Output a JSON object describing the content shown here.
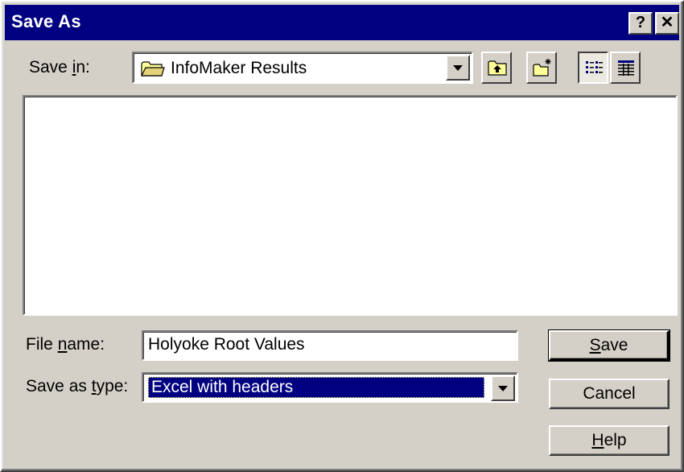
{
  "window": {
    "title": "Save As",
    "help_glyph": "?",
    "close_glyph": "✕"
  },
  "save_in": {
    "label": "Save in:",
    "label_plain": "Save ",
    "label_accel": "i",
    "label_rest": "n:",
    "value": "InfoMaker Results",
    "icon": "folder-icon"
  },
  "toolbar": {
    "up_folder_icon": "up-one-level-icon",
    "new_folder_icon": "new-folder-icon",
    "list_view_icon": "list-view-icon",
    "details_view_icon": "details-view-icon",
    "active_view": "list"
  },
  "file_list": {
    "items": []
  },
  "file_name": {
    "label_plain": "File ",
    "label_accel": "n",
    "label_rest": "ame:",
    "value": "Holyoke Root Values"
  },
  "save_as_type": {
    "label_plain": "Save as ",
    "label_accel": "t",
    "label_rest": "ype:",
    "selected": "Excel with headers"
  },
  "buttons": {
    "save_accel": "S",
    "save_rest": "ave",
    "cancel": "Cancel",
    "help_accel": "H",
    "help_rest": "elp"
  },
  "colors": {
    "titlebar": "#000080",
    "face": "#d4d0c8",
    "selection": "#000080"
  }
}
